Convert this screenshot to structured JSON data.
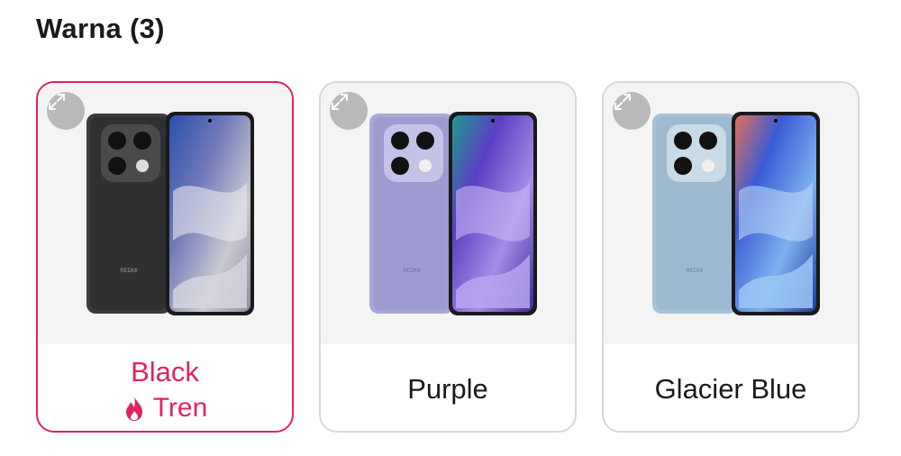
{
  "section": {
    "title": "Warna (3)"
  },
  "colors": [
    {
      "name": "Black",
      "badge": "Tren",
      "selected": true,
      "body_color": "#3a3b3d",
      "body_dark": "#232425",
      "camera_ring": "#4a4b4d",
      "brand": "REDMI",
      "icon": "expand-icon"
    },
    {
      "name": "Purple",
      "selected": false,
      "body_color": "#a9a6d8",
      "body_dark": "#8784c0",
      "camera_ring": "#c4c2e6",
      "brand": "REDMI",
      "icon": "expand-icon"
    },
    {
      "name": "Glacier Blue",
      "selected": false,
      "body_color": "#a6c2d6",
      "body_dark": "#7fa2bb",
      "camera_ring": "#c9dbe7",
      "brand": "REDMI",
      "icon": "expand-icon"
    }
  ],
  "accent_color": "#e0245e",
  "trend_icon": "flame-icon"
}
